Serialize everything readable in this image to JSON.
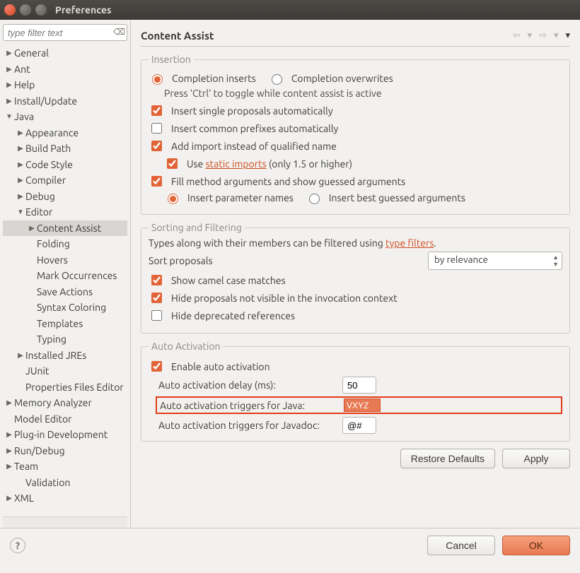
{
  "window": {
    "title": "Preferences"
  },
  "sidebar": {
    "filter_placeholder": "type filter text",
    "items": [
      {
        "label": "General",
        "indent": 0,
        "arrow": "right"
      },
      {
        "label": "Ant",
        "indent": 0,
        "arrow": "right"
      },
      {
        "label": "Help",
        "indent": 0,
        "arrow": "right"
      },
      {
        "label": "Install/Update",
        "indent": 0,
        "arrow": "right"
      },
      {
        "label": "Java",
        "indent": 0,
        "arrow": "down"
      },
      {
        "label": "Appearance",
        "indent": 1,
        "arrow": "right"
      },
      {
        "label": "Build Path",
        "indent": 1,
        "arrow": "right"
      },
      {
        "label": "Code Style",
        "indent": 1,
        "arrow": "right"
      },
      {
        "label": "Compiler",
        "indent": 1,
        "arrow": "right"
      },
      {
        "label": "Debug",
        "indent": 1,
        "arrow": "right"
      },
      {
        "label": "Editor",
        "indent": 1,
        "arrow": "down"
      },
      {
        "label": "Content Assist",
        "indent": 2,
        "arrow": "right",
        "selected": true
      },
      {
        "label": "Folding",
        "indent": 2,
        "arrow": ""
      },
      {
        "label": "Hovers",
        "indent": 2,
        "arrow": ""
      },
      {
        "label": "Mark Occurrences",
        "indent": 2,
        "arrow": ""
      },
      {
        "label": "Save Actions",
        "indent": 2,
        "arrow": ""
      },
      {
        "label": "Syntax Coloring",
        "indent": 2,
        "arrow": ""
      },
      {
        "label": "Templates",
        "indent": 2,
        "arrow": ""
      },
      {
        "label": "Typing",
        "indent": 2,
        "arrow": ""
      },
      {
        "label": "Installed JREs",
        "indent": 1,
        "arrow": "right"
      },
      {
        "label": "JUnit",
        "indent": 1,
        "arrow": ""
      },
      {
        "label": "Properties Files Editor",
        "indent": 1,
        "arrow": ""
      },
      {
        "label": "Memory Analyzer",
        "indent": 0,
        "arrow": "right"
      },
      {
        "label": "Model Editor",
        "indent": 0,
        "arrow": ""
      },
      {
        "label": "Plug-in Development",
        "indent": 0,
        "arrow": "right"
      },
      {
        "label": "Run/Debug",
        "indent": 0,
        "arrow": "right"
      },
      {
        "label": "Team",
        "indent": 0,
        "arrow": "right"
      },
      {
        "label": "Validation",
        "indent": 1,
        "arrow": ""
      },
      {
        "label": "XML",
        "indent": 0,
        "arrow": "right"
      }
    ]
  },
  "page": {
    "title": "Content Assist"
  },
  "insertion": {
    "legend": "Insertion",
    "completion_inserts": "Completion inserts",
    "completion_overwrites": "Completion overwrites",
    "hint": "Press 'Ctrl' to toggle while content assist is active",
    "insert_single": "Insert single proposals automatically",
    "insert_common_prefixes": "Insert common prefixes automatically",
    "add_import": "Add import instead of qualified name",
    "use_text": "Use ",
    "static_imports_link": "static imports",
    "use_suffix": " (only 1.5 or higher)",
    "fill_args": "Fill method arguments and show guessed arguments",
    "insert_param_names": "Insert parameter names",
    "insert_best_guessed": "Insert best guessed arguments"
  },
  "sorting": {
    "legend": "Sorting and Filtering",
    "hint_prefix": "Types along with their members can be filtered using ",
    "type_filters_link": "type filters",
    "hint_suffix": ".",
    "sort_label": "Sort proposals",
    "sort_value": "by relevance",
    "camel": "Show camel case matches",
    "hide_not_visible": "Hide proposals not visible in the invocation context",
    "hide_deprecated": "Hide deprecated references"
  },
  "auto": {
    "legend": "Auto Activation",
    "enable": "Enable auto activation",
    "delay_label": "Auto activation delay (ms):",
    "delay_value": "50",
    "triggers_java_label": "Auto activation triggers for Java:",
    "triggers_java_value": "VXYZ",
    "triggers_javadoc_label": "Auto activation triggers for Javadoc:",
    "triggers_javadoc_value": "@#"
  },
  "buttons": {
    "restore": "Restore Defaults",
    "apply": "Apply",
    "cancel": "Cancel",
    "ok": "OK"
  }
}
